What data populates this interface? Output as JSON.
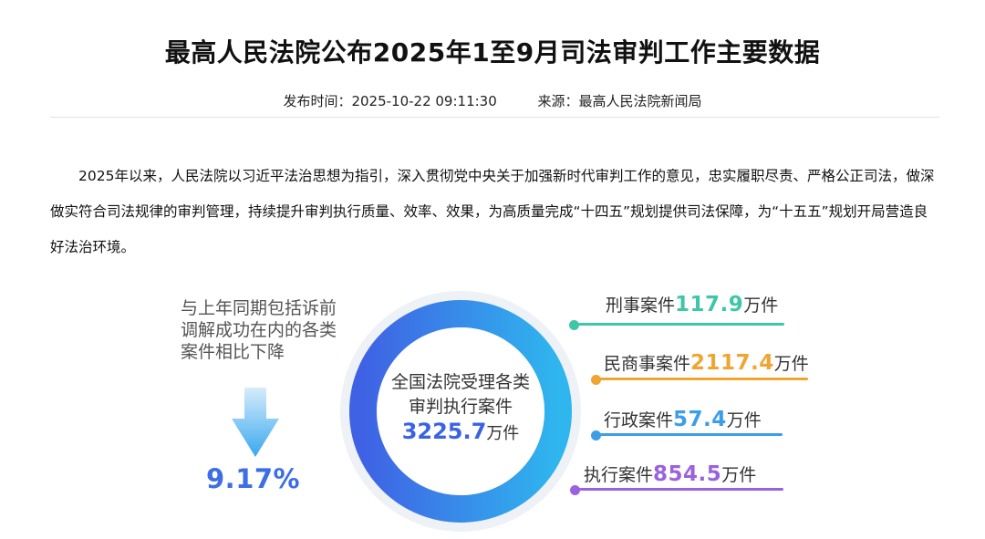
{
  "article": {
    "title": "最高人民法院公布2025年1至9月司法审判工作主要数据",
    "publish_time": "发布时间：2025-10-22 09:11:30",
    "source": "来源：最高人民法院新闻局",
    "paragraph": "2025年以来，人民法院以习近平法治思想为指引，深入贯彻党中央关于加强新时代审判工作的意见，忠实履职尽责、严格公正司法，做深做实符合司法规律的审判管理，持续提升审判执行质量、效率、效果，为高质量完成“十四五”规划提供司法保障，为“十五五”规划开局营造良好法治环境。"
  },
  "infographic": {
    "decline_text": "与上年同期包括诉前调解成功在内的各类案件相比下降",
    "decline_pct": "9.17%",
    "center_line1": "全国法院受理各类",
    "center_line2": "审判执行案件",
    "total_value": "3225.7",
    "total_unit": "万件",
    "categories": [
      {
        "label": "刑事案件",
        "value": "117.9",
        "unit": "万件",
        "color": "#3fc6a8"
      },
      {
        "label": "民商事案件",
        "value": "2117.4",
        "unit": "万件",
        "color": "#f0a531"
      },
      {
        "label": "行政案件",
        "value": "57.4",
        "unit": "万件",
        "color": "#3d9ee8"
      },
      {
        "label": "执行案件",
        "value": "854.5",
        "unit": "万件",
        "color": "#9a63dd"
      }
    ],
    "colors": {
      "accent_blue": "#3d6ee6",
      "ring_start": "#3f62e4",
      "ring_end": "#2fb6ee"
    }
  }
}
